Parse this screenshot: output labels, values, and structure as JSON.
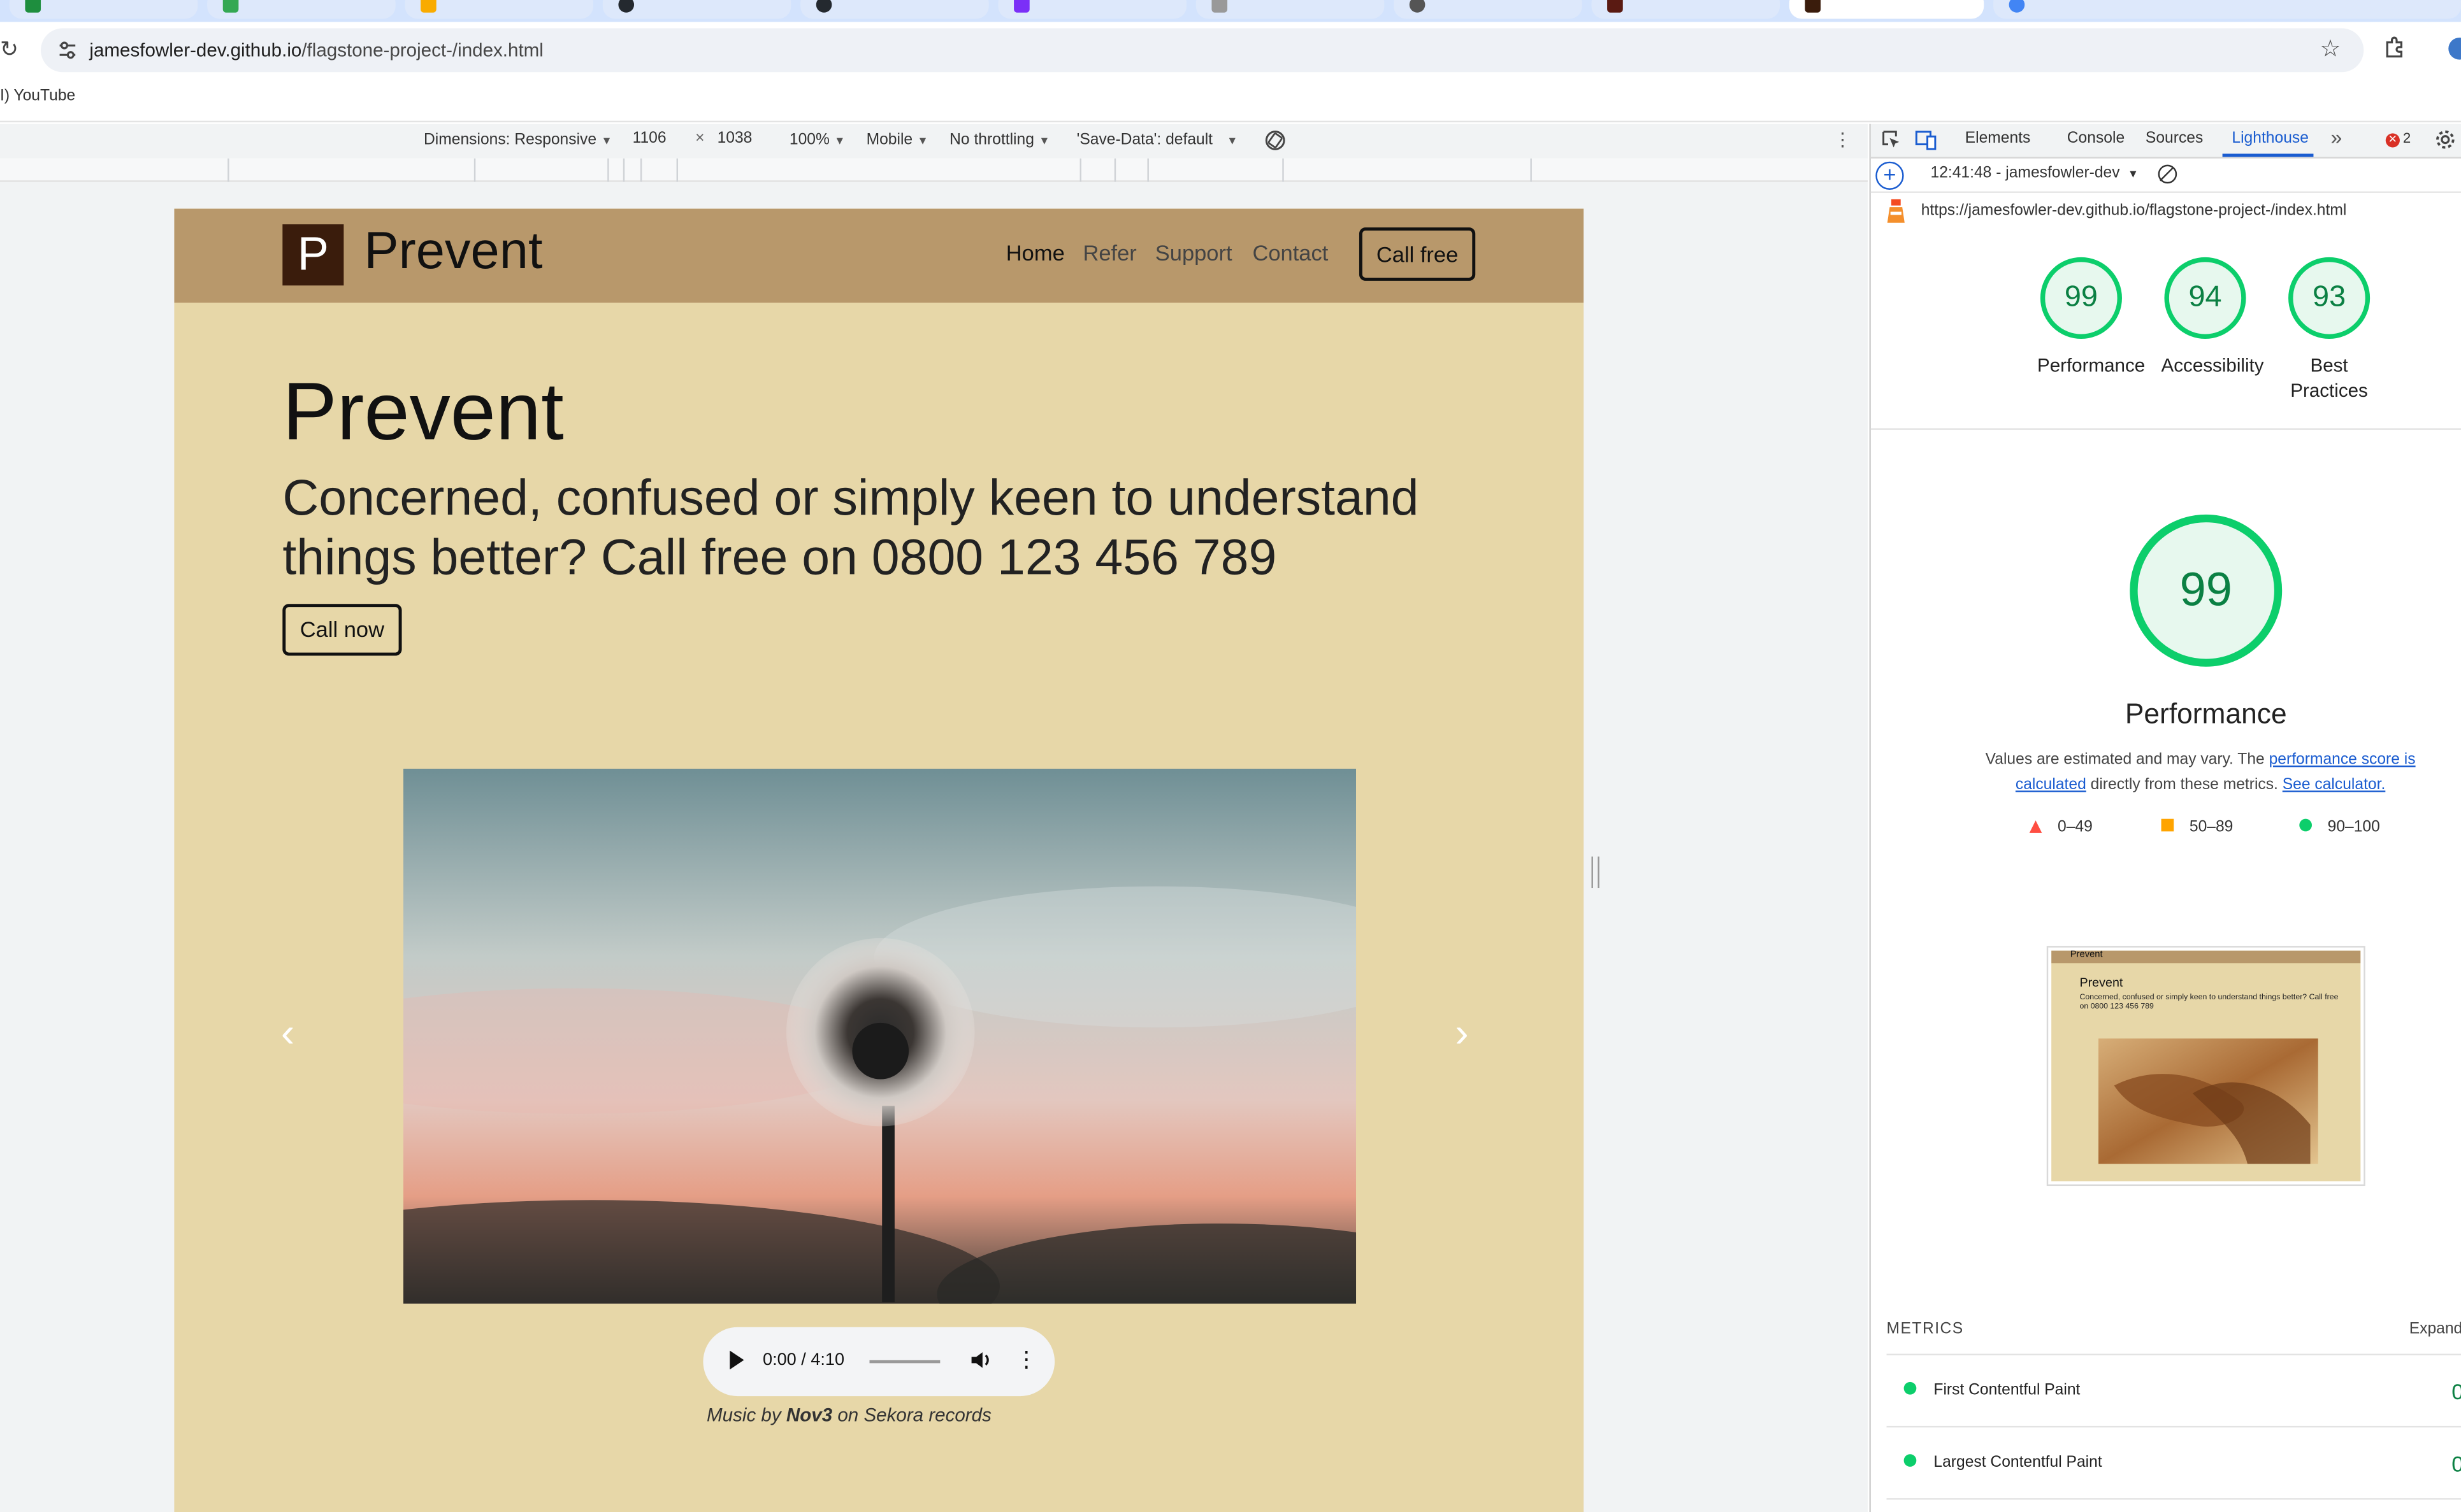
{
  "browser": {
    "url_host": "jamesfowler-dev.github.io",
    "url_path": "/flagstone-project-/index.html",
    "bookmark": "I) YouTube"
  },
  "device_toolbar": {
    "dimensions_label": "Dimensions: Responsive",
    "width": "1106",
    "times": "×",
    "height": "1038",
    "zoom": "100%",
    "device": "Mobile",
    "throttling": "No throttling",
    "save_data": "'Save-Data': default"
  },
  "site": {
    "logo_letter": "P",
    "brand": "Prevent",
    "nav": [
      "Home",
      "Refer",
      "Support",
      "Contact"
    ],
    "cta": "Call free",
    "hero_title": "Prevent",
    "hero_subtitle": "Concerned, confused or simply keen to understand things better? Call free on 0800 123 456 789",
    "call_now": "Call now",
    "audio_time": "0:00 / 4:10",
    "credit_prefix": "Music by ",
    "credit_artist": "Nov3",
    "credit_suffix": " on Sekora records"
  },
  "devtools": {
    "tabs": [
      "Elements",
      "Console",
      "Sources",
      "Lighthouse"
    ],
    "more_tabs": "»",
    "error_count": "2",
    "report_label": "12:41:48 - jamesfowler-dev",
    "report_url": "https://jamesfowler-dev.github.io/flagstone-project-/index.html",
    "scores": [
      {
        "value": "99",
        "label": "Performance"
      },
      {
        "value": "94",
        "label": "Accessibility"
      },
      {
        "value": "93",
        "label": "Best Practices"
      }
    ],
    "main_score": "99",
    "main_title": "Performance",
    "desc_1": "Values are estimated and may vary. The ",
    "desc_link_1": "performance score is calculated",
    "desc_2": " directly from these metrics. ",
    "desc_link_2": "See calculator.",
    "legend": [
      "0–49",
      "50–89",
      "90–100"
    ],
    "thumb_brand": "Prevent",
    "thumb_title": "Prevent",
    "thumb_sub": "Concerned, confused or simply keen to understand things better? Call free on 0800 123 456 789",
    "metrics_heading": "METRICS",
    "expand_label": "Expand",
    "metrics": [
      "First Contentful Paint",
      "Largest Contentful Paint"
    ],
    "metric_value_glyph": "0"
  },
  "colors": {
    "header": "#b8986b",
    "body": "#e7d7a8",
    "pass": "#0cce6b",
    "link": "#1a5cd0"
  }
}
